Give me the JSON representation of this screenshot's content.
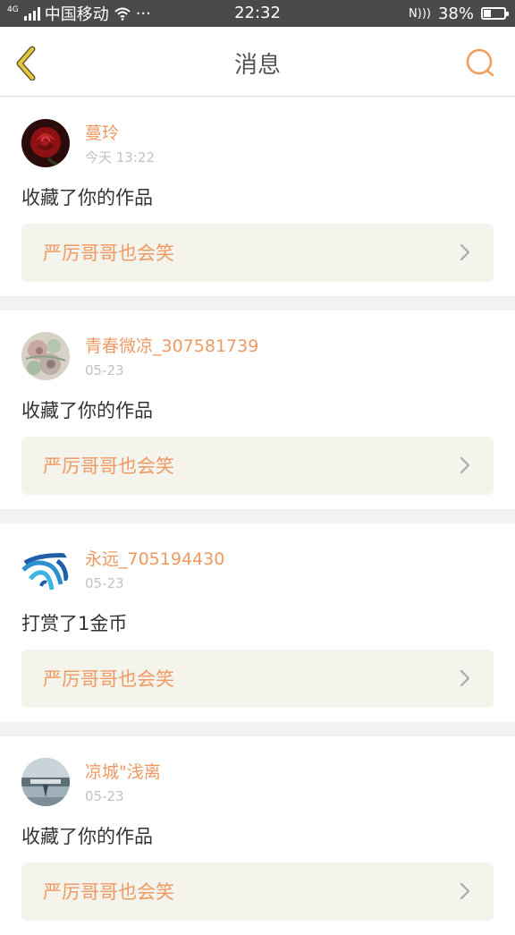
{
  "status_bar": {
    "network_type": "4G",
    "carrier": "中国移动",
    "more": "···",
    "time": "22:32",
    "nfc": "N",
    "battery_percent_text": "38%",
    "battery_level": 0.38
  },
  "nav": {
    "title": "消息",
    "back_icon": "chevron-left-icon",
    "search_icon": "search-icon",
    "accent_color": "#f0a05a",
    "back_color": "#e8c53a"
  },
  "messages": [
    {
      "username": "蔓玲",
      "time": "今天 13:22",
      "action": "收藏了你的作品",
      "work_title": "严厉哥哥也会笑",
      "avatar": "rose-avatar"
    },
    {
      "username": "青春微凉_307581739",
      "time": "05-23",
      "action": "收藏了你的作品",
      "work_title": "严厉哥哥也会笑",
      "avatar": "floral-avatar"
    },
    {
      "username": "永远_705194430",
      "time": "05-23",
      "action": "打赏了1金币",
      "work_title": "严厉哥哥也会笑",
      "avatar": "blue-waves-avatar"
    },
    {
      "username": "凉城\"浅离",
      "time": "05-23",
      "action": "收藏了你的作品",
      "work_title": "严厉哥哥也会笑",
      "avatar": "photo-avatar"
    }
  ],
  "colors": {
    "username": "#ee9a63",
    "work_title": "#ee9a63",
    "work_bg": "#f4f3ec",
    "timestamp": "#c2c2c2"
  }
}
